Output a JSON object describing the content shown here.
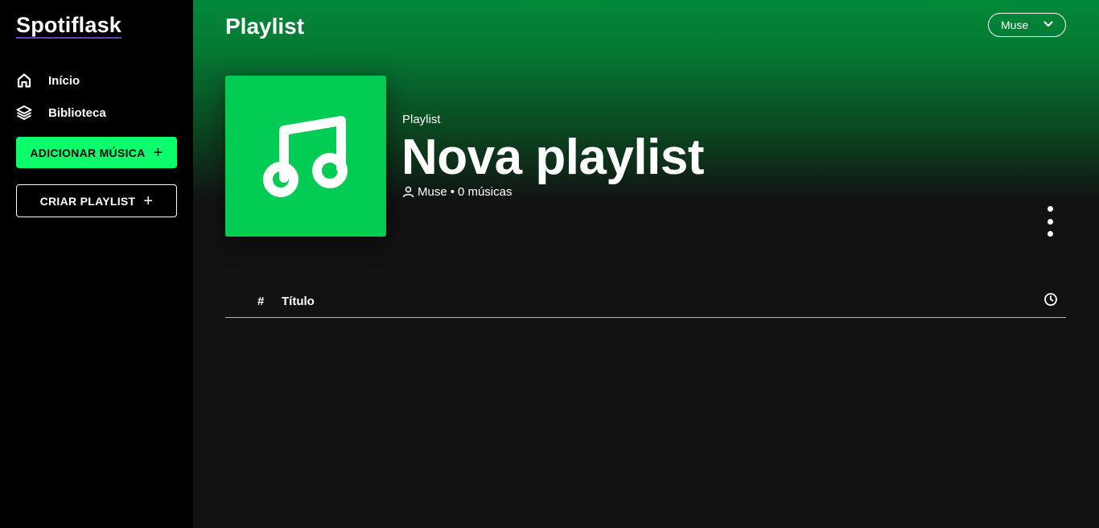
{
  "app": {
    "name": "Spotiflask"
  },
  "sidebar": {
    "nav": [
      {
        "label": "Início",
        "icon": "home-icon"
      },
      {
        "label": "Biblioteca",
        "icon": "layers-icon"
      }
    ],
    "add_music_label": "ADICIONAR MÚSICA",
    "create_playlist_label": "CRIAR PLAYLIST"
  },
  "header": {
    "title": "Playlist",
    "user": "Muse"
  },
  "playlist": {
    "type": "Playlist",
    "name": "Nova playlist",
    "owner": "Muse",
    "separator": "•",
    "song_count": "0 músicas"
  },
  "table": {
    "col_number": "#",
    "col_title": "Título",
    "col_duration_icon": "clock-icon"
  },
  "colors": {
    "accent": "#0cff6b",
    "cover": "#03cc55",
    "sidebar": "#000000",
    "background": "#121212"
  }
}
